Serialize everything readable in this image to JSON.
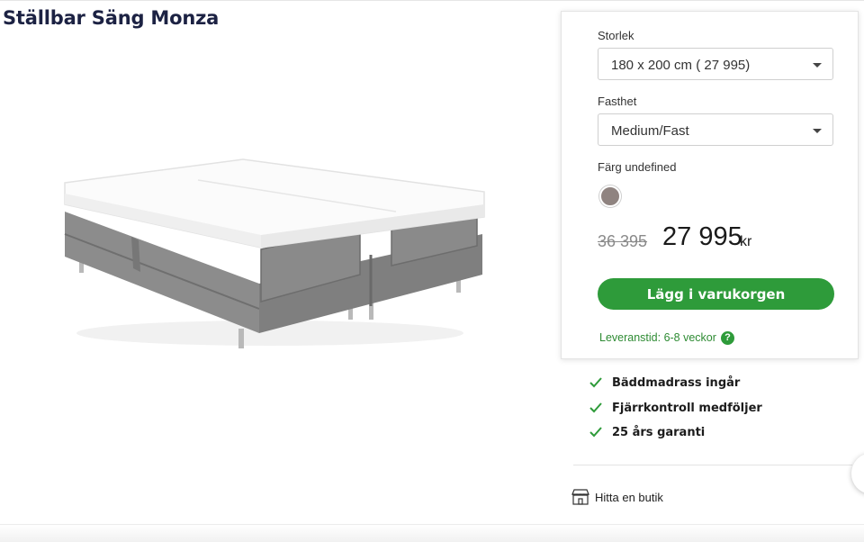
{
  "product": {
    "title": "Ställbar Säng Monza"
  },
  "options": {
    "size_label": "Storlek",
    "size_value": "180 x 200 cm ( 27 995)",
    "firmness_label": "Fasthet",
    "firmness_value": "Medium/Fast",
    "color_label": "Färg undefined",
    "swatch_color": "#8f8380"
  },
  "price": {
    "old": "36 395",
    "current": "27 995",
    "currency": "kr"
  },
  "cart": {
    "button_label": "Lägg i varukorgen",
    "accent": "#2e9b3a"
  },
  "delivery": {
    "text": "Leveranstid: 6-8 veckor",
    "help_icon": "question-circle-icon"
  },
  "features": [
    {
      "text": "Bäddmadrass ingår",
      "icon": "check-icon"
    },
    {
      "text": "Fjärrkontroll medföljer",
      "icon": "check-icon"
    },
    {
      "text": "25 års garanti",
      "icon": "check-icon"
    }
  ],
  "store": {
    "link_label": "Hitta en butik",
    "icon": "store-icon"
  }
}
